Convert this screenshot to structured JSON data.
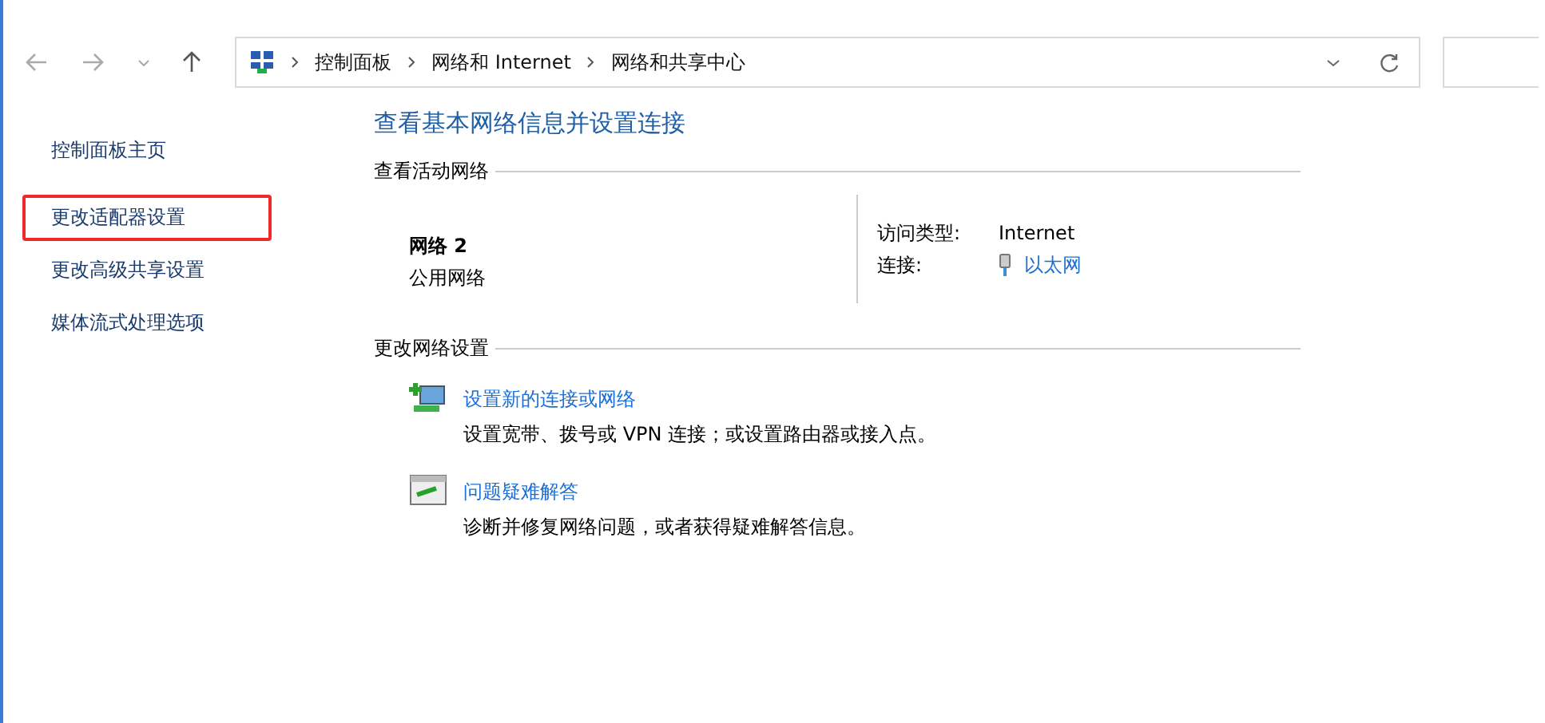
{
  "nav": {
    "breadcrumb": [
      "控制面板",
      "网络和 Internet",
      "网络和共享中心"
    ]
  },
  "sidebar": {
    "items": [
      {
        "label": "控制面板主页",
        "highlighted": false
      },
      {
        "label": "更改适配器设置",
        "highlighted": true
      },
      {
        "label": "更改高级共享设置",
        "highlighted": false
      },
      {
        "label": "媒体流式处理选项",
        "highlighted": false
      }
    ]
  },
  "main": {
    "title": "查看基本网络信息并设置连接",
    "active_section": "查看活动网络",
    "network": {
      "name": "网络 2",
      "category": "公用网络",
      "access_label": "访问类型:",
      "access_value": "Internet",
      "connection_label": "连接:",
      "connection_value": "以太网"
    },
    "settings_section": "更改网络设置",
    "tasks": [
      {
        "kind": "new-connection",
        "link": "设置新的连接或网络",
        "description": "设置宽带、拨号或 VPN 连接；或设置路由器或接入点。"
      },
      {
        "kind": "troubleshoot",
        "link": "问题疑难解答",
        "description": "诊断并修复网络问题，或者获得疑难解答信息。"
      }
    ]
  }
}
